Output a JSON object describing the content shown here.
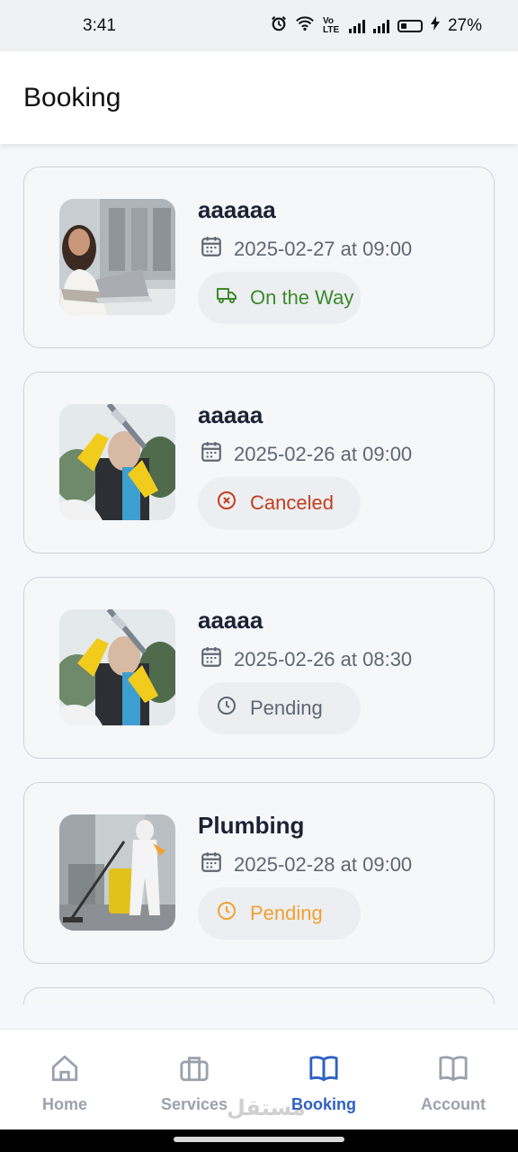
{
  "status_bar": {
    "time": "3:41",
    "volte": "Vo LTE",
    "battery": "27%"
  },
  "header": {
    "title": "Booking"
  },
  "bookings": [
    {
      "title": "aaaaaa",
      "date": "2025-02-27 at 09:00",
      "status": "On the Way",
      "status_icon": "truck-icon",
      "status_color": "#3c8a2c",
      "image": "woman-laptop-photo"
    },
    {
      "title": "aaaaa",
      "date": "2025-02-26 at 09:00",
      "status": "Canceled",
      "status_icon": "x-circle-icon",
      "status_color": "#c43d1c",
      "image": "window-cleaning-photo"
    },
    {
      "title": "aaaaa",
      "date": "2025-02-26 at 08:30",
      "status": "Pending",
      "status_icon": "clock-icon",
      "status_color": "#5f6673",
      "image": "window-cleaning-photo"
    },
    {
      "title": "Plumbing",
      "date": "2025-02-28 at 09:00",
      "status": "Pending",
      "status_icon": "clock-icon",
      "status_color": "#f0a131",
      "image": "vacuum-cleaning-photo"
    }
  ],
  "nav": {
    "items": [
      {
        "label": "Home",
        "icon": "home-icon"
      },
      {
        "label": "Services",
        "icon": "briefcase-icon"
      },
      {
        "label": "Booking",
        "icon": "book-icon",
        "active": true
      },
      {
        "label": "Account",
        "icon": "book-icon"
      }
    ],
    "active_color": "#2f5fc4"
  },
  "watermark": "مستقل"
}
